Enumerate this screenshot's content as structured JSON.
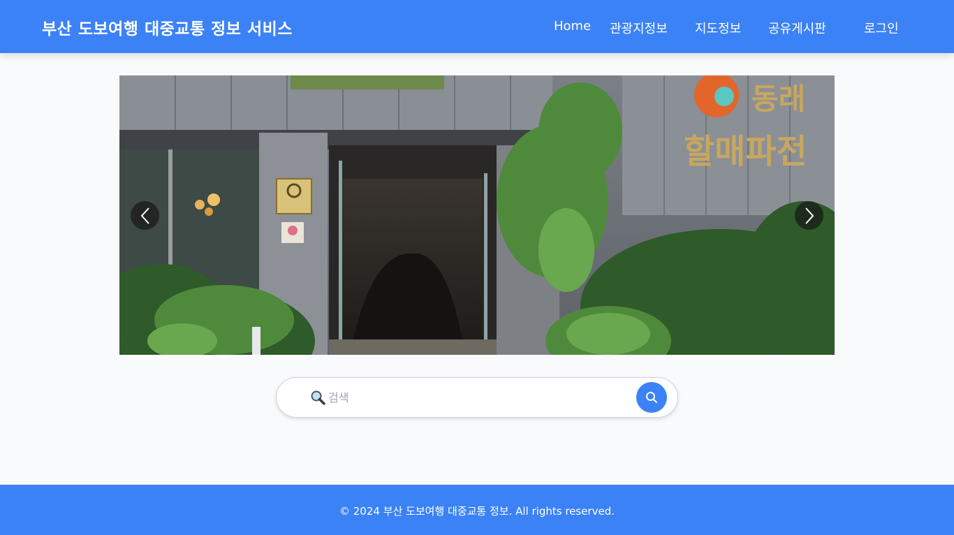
{
  "header": {
    "title": "부산 도보여행 대중교통 정보 서비스",
    "nav": [
      {
        "label": "Home"
      },
      {
        "label": "관광지정보"
      },
      {
        "label": "지도정보"
      },
      {
        "label": "공유게시판"
      },
      {
        "label": "로그인"
      }
    ],
    "accent_color": "#3b82f6"
  },
  "carousel": {
    "sign_line1": "동래",
    "sign_line2": "할매파전",
    "prev_icon": "chevron-left-icon",
    "next_icon": "chevron-right-icon"
  },
  "search": {
    "placeholder": "검색",
    "leading_icon": "magnifier-emoji-icon",
    "button_icon": "search-icon"
  },
  "footer": {
    "text": "© 2024 부산 도보여행 대중교통 정보. All rights reserved."
  }
}
